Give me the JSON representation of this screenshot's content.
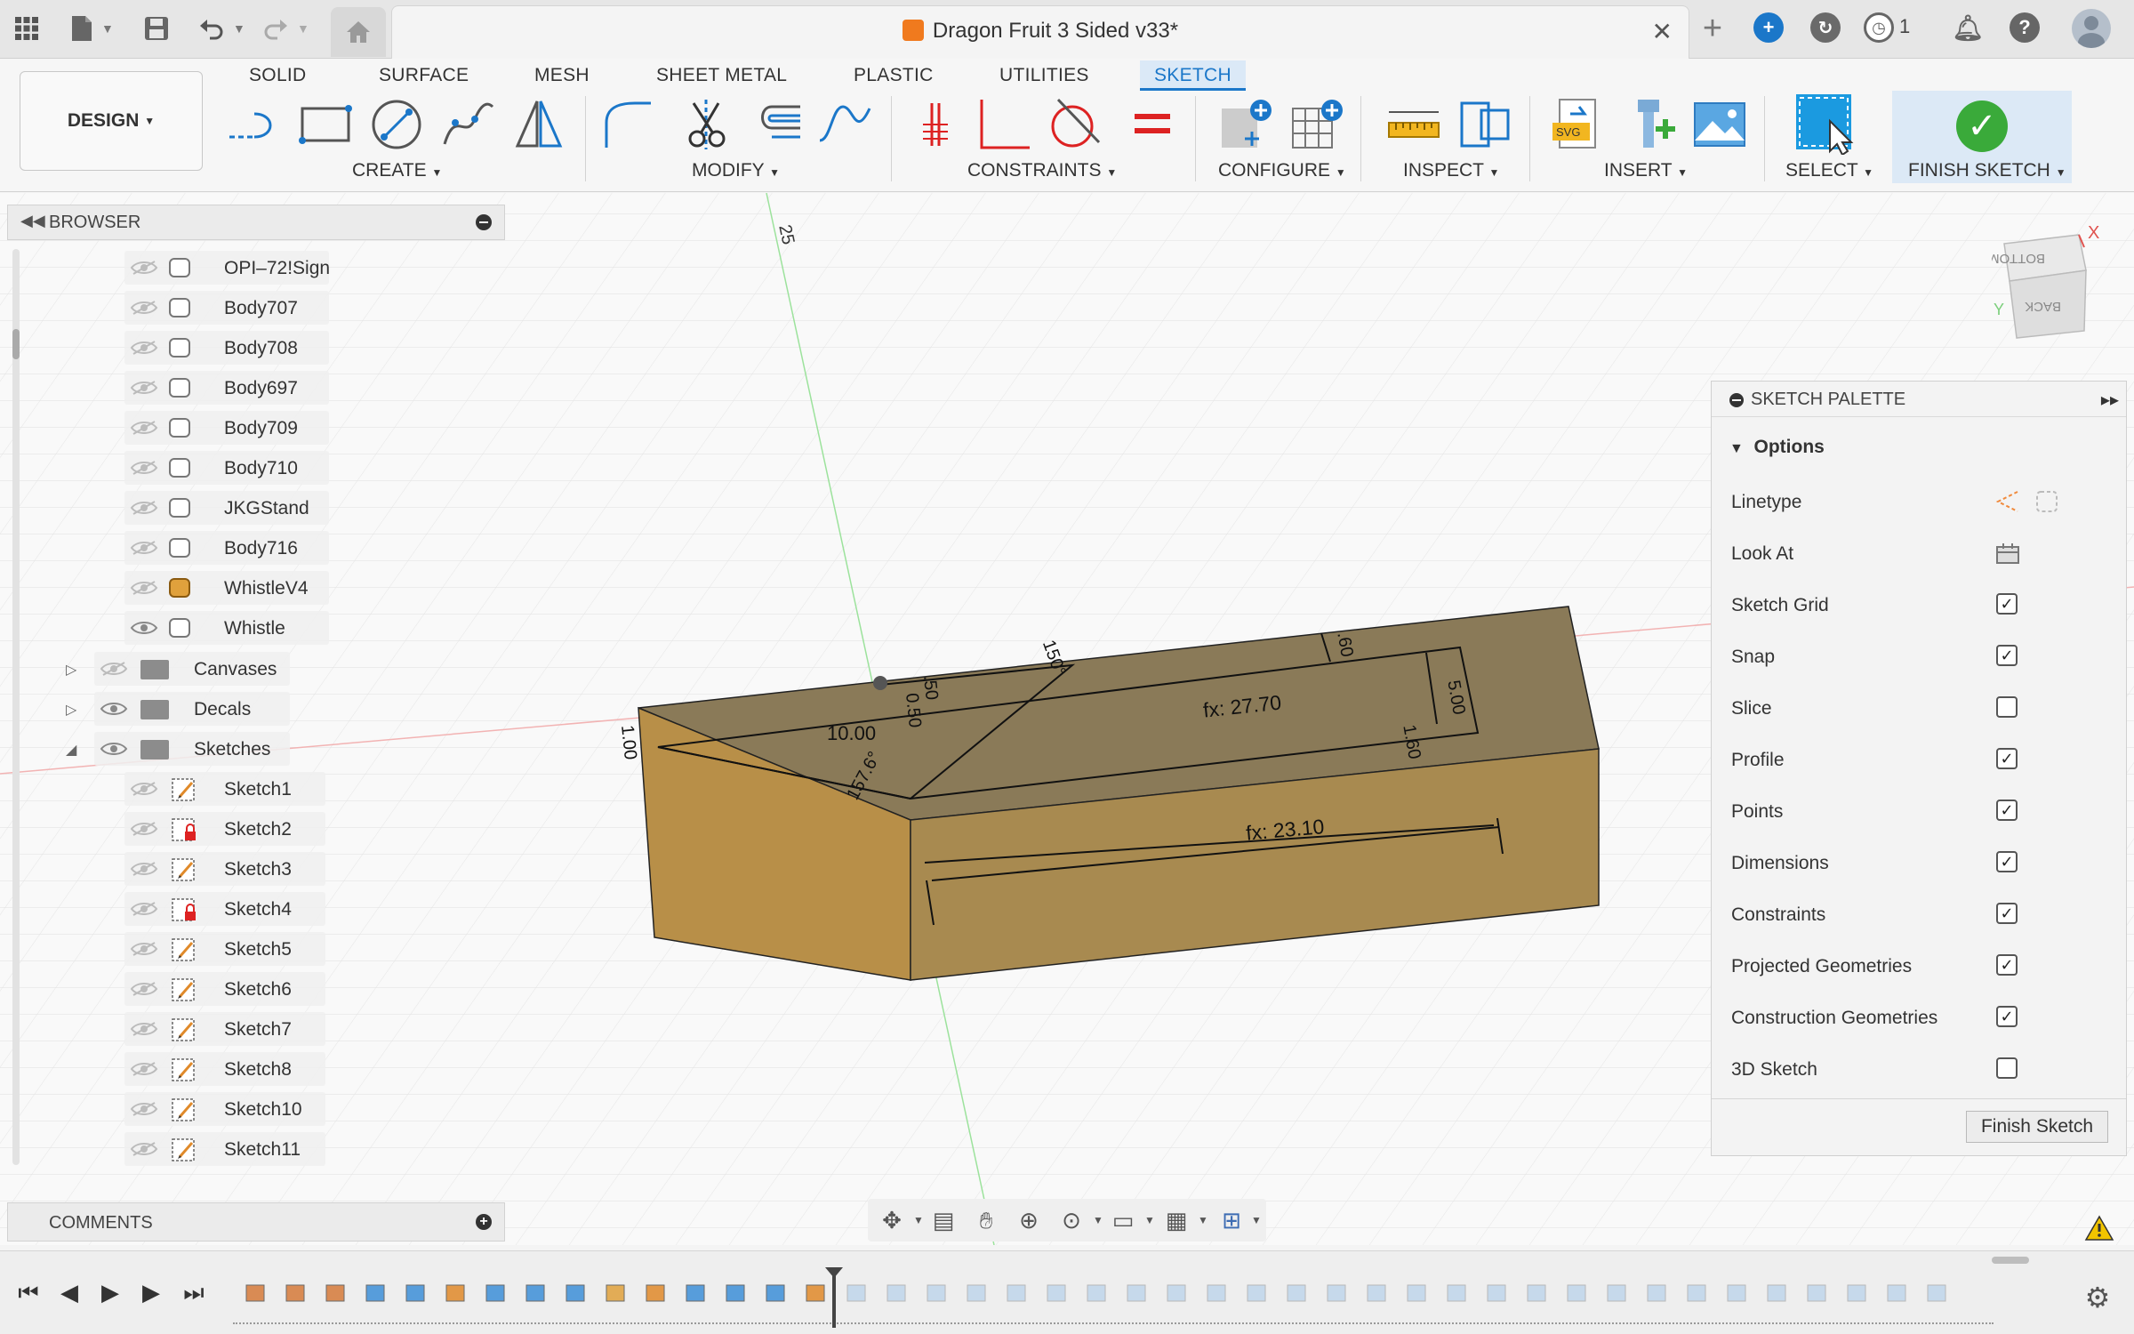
{
  "titlebar": {
    "document_title": "Dragon Fruit 3 Sided v33*",
    "job_count": "1"
  },
  "ribbon": {
    "workspace_button": "DESIGN",
    "tabs": [
      {
        "label": "SOLID",
        "active": false
      },
      {
        "label": "SURFACE",
        "active": false
      },
      {
        "label": "MESH",
        "active": false
      },
      {
        "label": "SHEET METAL",
        "active": false
      },
      {
        "label": "PLASTIC",
        "active": false
      },
      {
        "label": "UTILITIES",
        "active": false
      },
      {
        "label": "SKETCH",
        "active": true
      }
    ],
    "groups": {
      "create": "CREATE",
      "modify": "MODIFY",
      "constraints": "CONSTRAINTS",
      "configure": "CONFIGURE",
      "inspect": "INSPECT",
      "insert": "INSERT",
      "select": "SELECT",
      "finish": "FINISH SKETCH"
    },
    "accent_color": "#1b77c9"
  },
  "browser": {
    "title": "BROWSER",
    "items": [
      {
        "label": "OPI–72!Sign",
        "visible": false,
        "type": "body"
      },
      {
        "label": "Body707",
        "visible": false,
        "type": "body"
      },
      {
        "label": "Body708",
        "visible": false,
        "type": "body"
      },
      {
        "label": "Body697",
        "visible": false,
        "type": "body"
      },
      {
        "label": "Body709",
        "visible": false,
        "type": "body"
      },
      {
        "label": "Body710",
        "visible": false,
        "type": "body"
      },
      {
        "label": "JKGStand",
        "visible": false,
        "type": "body"
      },
      {
        "label": "Body716",
        "visible": false,
        "type": "body"
      },
      {
        "label": "WhistleV4",
        "visible": false,
        "type": "body-orange"
      },
      {
        "label": "Whistle",
        "visible": true,
        "type": "body"
      }
    ],
    "folders": [
      {
        "label": "Canvases",
        "expanded": false,
        "visible": false
      },
      {
        "label": "Decals",
        "expanded": false,
        "visible": true
      },
      {
        "label": "Sketches",
        "expanded": true,
        "visible": true
      }
    ],
    "sketches": [
      "Sketch1",
      "Sketch2",
      "Sketch3",
      "Sketch4",
      "Sketch5",
      "Sketch6",
      "Sketch7",
      "Sketch8",
      "Sketch10",
      "Sketch11"
    ]
  },
  "comments": {
    "label": "COMMENTS"
  },
  "viewport": {
    "axis_label": "25",
    "viewcube": {
      "top_face": "BOTTOM",
      "front_face": "BACK",
      "x_axis": "X",
      "y_axis": "Y"
    },
    "dimensions": {
      "d1": "1.00",
      "d2": "10.00",
      "d3": "0.50",
      "d4": ".50",
      "d5": "157.6°",
      "d6": "150°",
      "d7": "fx: 27.70",
      "d8": "fx: 23.10",
      "d9": "5.00",
      "d10": "1.60",
      "d11": ".60"
    }
  },
  "palette": {
    "title": "SKETCH PALETTE",
    "section": "Options",
    "linetype_label": "Linetype",
    "look_at_label": "Look At",
    "options": [
      {
        "label": "Sketch Grid",
        "checked": true
      },
      {
        "label": "Snap",
        "checked": true
      },
      {
        "label": "Slice",
        "checked": false
      },
      {
        "label": "Profile",
        "checked": true
      },
      {
        "label": "Points",
        "checked": true
      },
      {
        "label": "Dimensions",
        "checked": true
      },
      {
        "label": "Constraints",
        "checked": true
      },
      {
        "label": "Projected Geometries",
        "checked": true
      },
      {
        "label": "Construction Geometries",
        "checked": true
      },
      {
        "label": "3D Sketch",
        "checked": false
      }
    ],
    "finish_button": "Finish Sketch"
  },
  "navbar": {
    "icons": [
      "orbit-icon",
      "look-at-icon",
      "pan-icon",
      "zoom-icon",
      "zoom-window-icon",
      "display-settings-icon",
      "grid-settings-icon",
      "viewports-icon"
    ]
  },
  "timeline": {
    "controls": [
      "go-to-start",
      "previous-step",
      "play",
      "next-step",
      "go-to-end"
    ]
  }
}
